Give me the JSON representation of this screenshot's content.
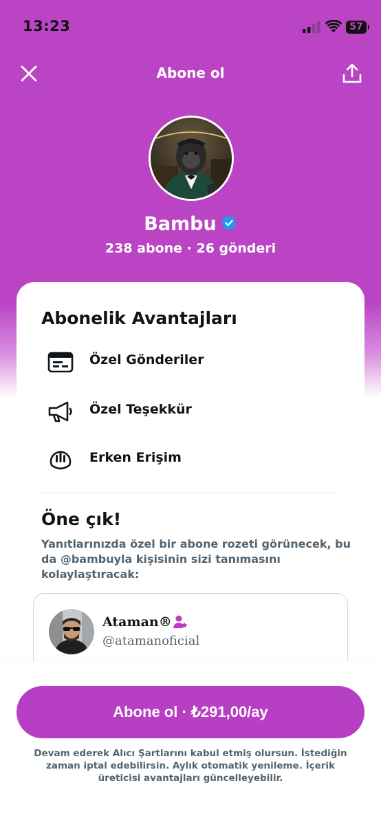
{
  "status_bar": {
    "time": "13:23",
    "battery": "57",
    "icons": [
      "signal-icon",
      "wifi-icon",
      "battery-icon"
    ]
  },
  "nav": {
    "title": "Abone ol",
    "close_icon": "close-icon",
    "share_icon": "share-icon"
  },
  "profile": {
    "name": "Bambu",
    "verified": true,
    "stats": "238 abone · 26 gönderi"
  },
  "benefits": {
    "title": "Abonelik Avantajları",
    "items": [
      {
        "label": "Özel Gönderiler",
        "icon": "exclusive-posts-icon"
      },
      {
        "label": "Özel Teşekkür",
        "icon": "megaphone-icon"
      },
      {
        "label": "Erken Erişim",
        "icon": "early-access-icon"
      }
    ]
  },
  "standout": {
    "title": "Öne çık!",
    "description": "Yanıtlarınızda özel bir abone rozeti görünecek, bu da @bambuyla kişisinin sizi tanımasını kolaylaştıracak:"
  },
  "preview": {
    "name": "Ataman®",
    "handle": "@atamanoficial",
    "badge_icon": "subscriber-badge-icon"
  },
  "footer": {
    "subscribe_label": "Abone ol · ₺291,00/ay",
    "legal_text": "Devam ederek Alıcı Şartlarını kabul etmiş olursun. İstediğin zaman iptal edebilirsin. Aylık otomatik yenileme. İçerik üreticisi avantajları güncelleyebilir."
  },
  "colors": {
    "brand": "#bb44c4",
    "button": "#b63fc3",
    "verified": "#1d9bf0",
    "badge": "#b63fc3",
    "text": "#0f1419",
    "muted": "#536471"
  }
}
